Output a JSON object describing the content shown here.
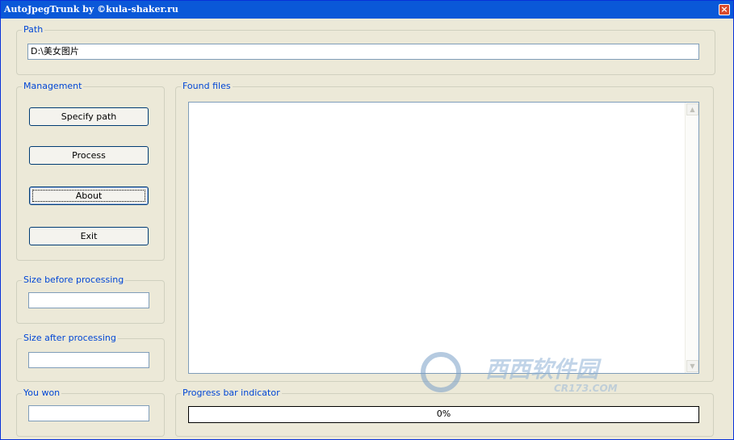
{
  "window": {
    "title": "AutoJpegTrunk by ©kula-shaker.ru",
    "close_glyph": "×"
  },
  "path_group": {
    "legend": "Path",
    "value": "D:\\美女图片"
  },
  "management": {
    "legend": "Management",
    "specify_label": "Specify path",
    "process_label": "Process",
    "about_label": "About",
    "exit_label": "Exit"
  },
  "size_before": {
    "legend": "Size before processing",
    "value": ""
  },
  "size_after": {
    "legend": "Size after processing",
    "value": ""
  },
  "you_won": {
    "legend": "You won",
    "value": ""
  },
  "found_files": {
    "legend": "Found files",
    "items": []
  },
  "progress": {
    "legend": "Progress bar indicator",
    "text": "0%",
    "fraction": 0
  },
  "watermark": {
    "text": "西西软件园",
    "subtext": "CR173.COM"
  }
}
